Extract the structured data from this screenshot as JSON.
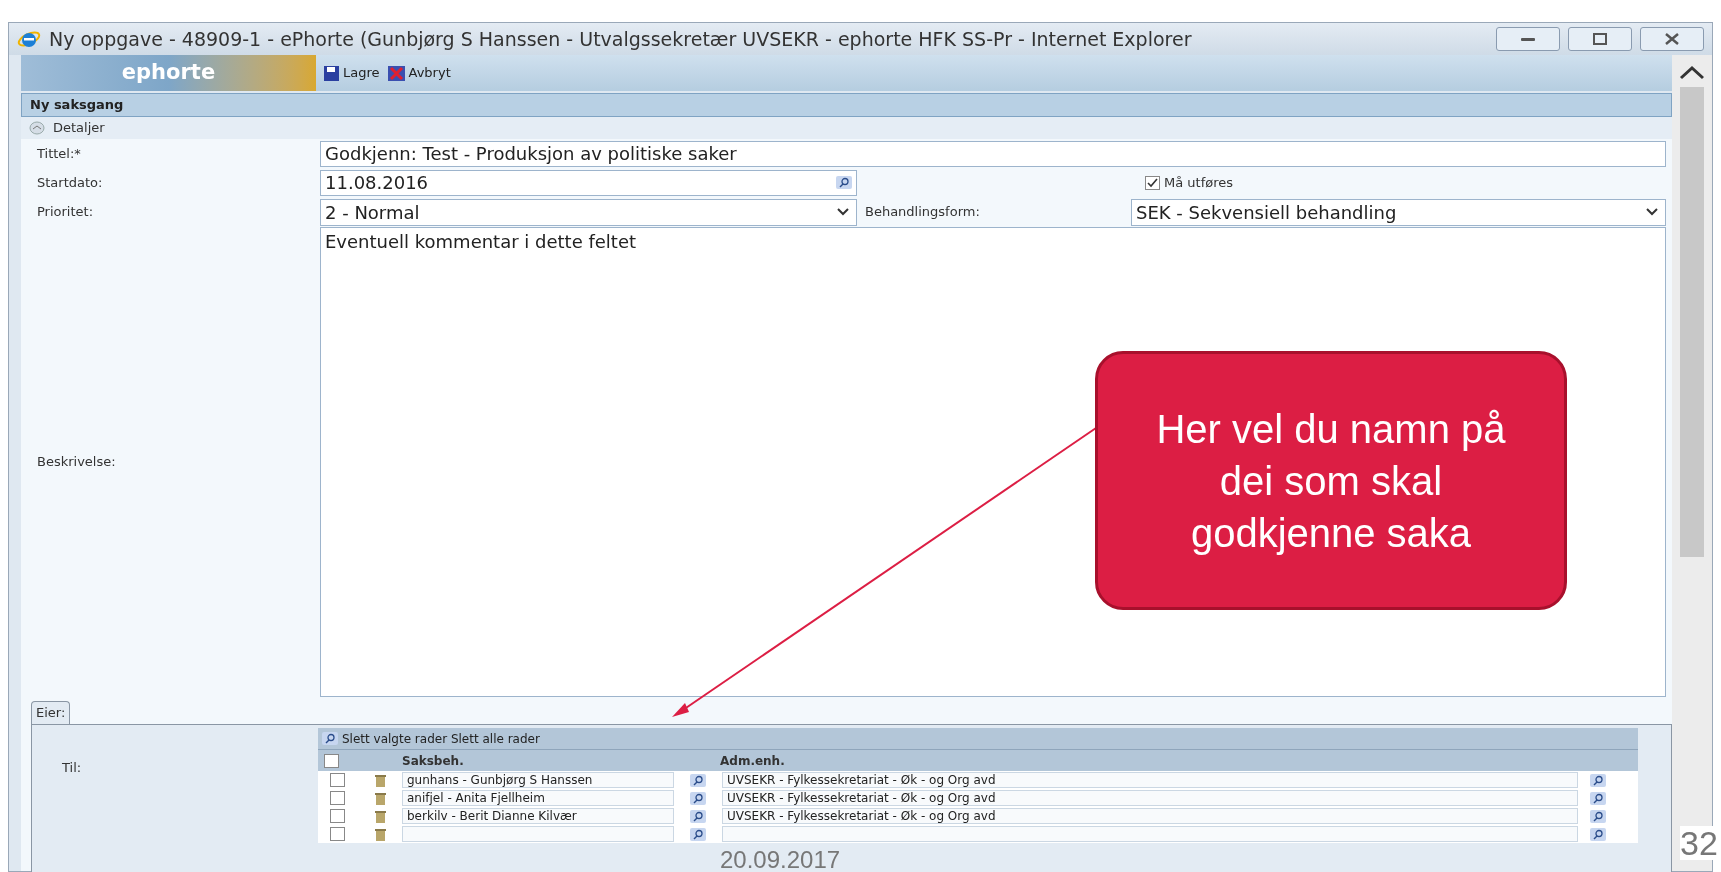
{
  "window": {
    "title": "Ny oppgave - 48909-1 - ePhorte (Gunbjørg S Hanssen - Utvalgssekretær UVSEKR - ephorte HFK SS-Pr - Internet Explorer"
  },
  "app": {
    "logo": "ephorte",
    "toolbar": [
      {
        "kind": "save",
        "label": "Lagre"
      },
      {
        "kind": "cancel",
        "label": "Avbryt"
      }
    ]
  },
  "section": {
    "title": "Ny saksgang",
    "group": "Detaljer"
  },
  "form": {
    "tittel_label": "Tittel:*",
    "tittel": "Godkjenn: Test - Produksjon av politiske saker",
    "startdato_label": "Startdato:",
    "startdato": "11.08.2016",
    "ma_utfores": {
      "label": "Må utføres",
      "checked": true
    },
    "prioritet_label": "Prioritet:",
    "prioritet": "2 - Normal",
    "behandlingsform_label": "Behandlingsform:",
    "behandlingsform": "SEK - Sekvensiell behandling",
    "beskrivelse_label": "Beskrivelse:",
    "beskrivelse": "Eventuell kommentar i dette feltet"
  },
  "tabs": [
    {
      "label": "Eier:",
      "selected": true
    }
  ],
  "til": {
    "label": "Til:",
    "all_checked": false,
    "actions": "Slett valgte rader Slett alle rader",
    "columns": [
      "Saksbeh.",
      "Adm.enh."
    ],
    "rows": [
      {
        "checked": false,
        "saksbeh": "gunhans - Gunbjørg S Hanssen",
        "adm": "UVSEKR - Fylkessekretariat - Øk - og Org avd"
      },
      {
        "checked": false,
        "saksbeh": "anifjel - Anita Fjellheim",
        "adm": "UVSEKR - Fylkessekretariat - Øk - og Org avd"
      },
      {
        "checked": false,
        "saksbeh": "berkilv - Berit Dianne Kilvær",
        "adm": "UVSEKR - Fylkessekretariat - Øk - og Org avd"
      },
      {
        "checked": false,
        "saksbeh": "",
        "adm": ""
      }
    ]
  },
  "callout": {
    "text": "Her vel du namn på dei som skal godkjenne saka"
  },
  "slide": {
    "date": "20.09.2017",
    "page": "32"
  }
}
